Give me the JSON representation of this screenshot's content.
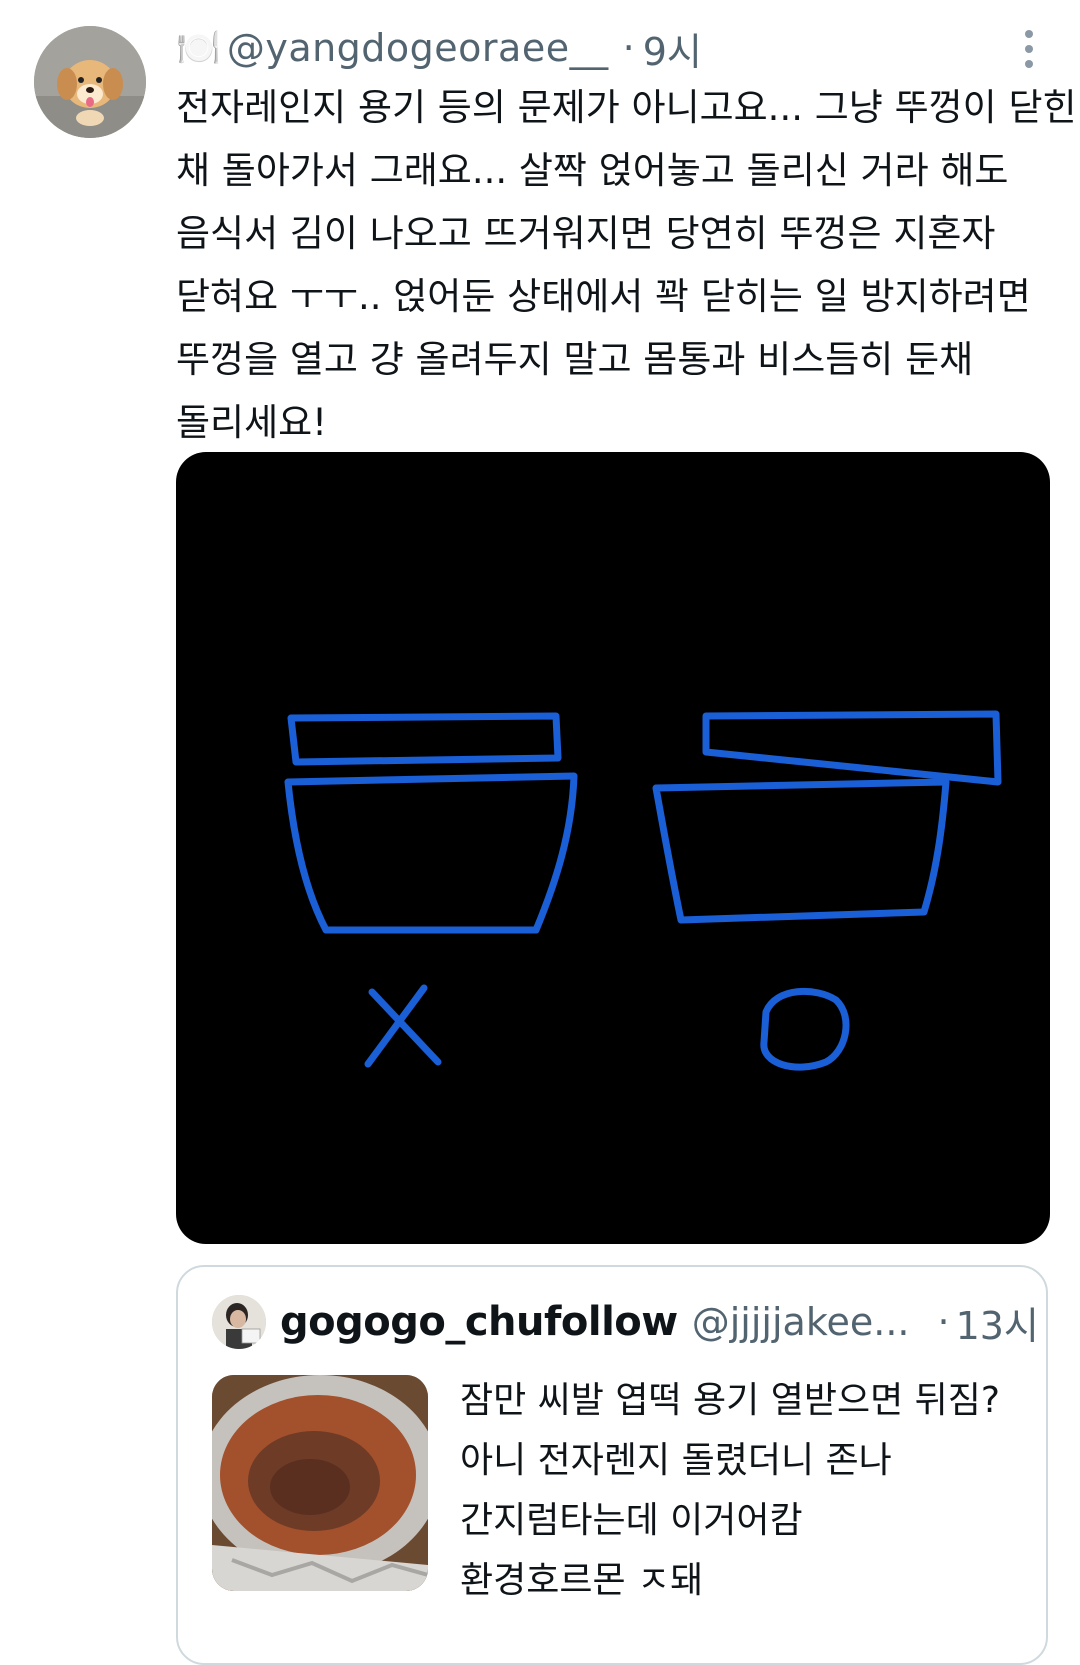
{
  "tweet": {
    "author": {
      "name_emoji": "🍽️",
      "handle": "@yangdogeoraee__",
      "avatar": "puppy-avatar"
    },
    "separator": "·",
    "time": "9시",
    "more_icon": "more-vertical-icon",
    "text_lines": [
      "전자레인지 용기 등의 문제가 아니고요... 그냥 뚜껑이 닫힌",
      "채 돌아가서 그래요... 살짝 얹어놓고 돌리신 거라 해도",
      "음식서 김이 나오고 뜨거워지면 당연히 뚜껑은 지혼자",
      "닫혀요 ㅜㅜ.. 얹어둔 상태에서 꽉 닫히는 일 방지하려면",
      "뚜껑을 열고 걍 올려두지 말고 몸통과 비스듬히 둔채",
      "돌리세요!"
    ],
    "image": {
      "background": "#000000",
      "stroke_color": "#1a5fd6",
      "labels": [
        "X",
        "O"
      ]
    }
  },
  "quote": {
    "name": "gogogo_chufollow",
    "handle": "@jjjjjakee...",
    "separator": "·",
    "time": "13시",
    "text_lines": [
      "잠만 씨발 엽떡 용기 열받으면 뒤짐?",
      "아니 전자렌지 돌렸더니 존나",
      "간지럼타는데 이거어캄",
      "환경호르몬 ㅈ돼"
    ],
    "thumbnail": "tteokbokki-container-photo"
  }
}
